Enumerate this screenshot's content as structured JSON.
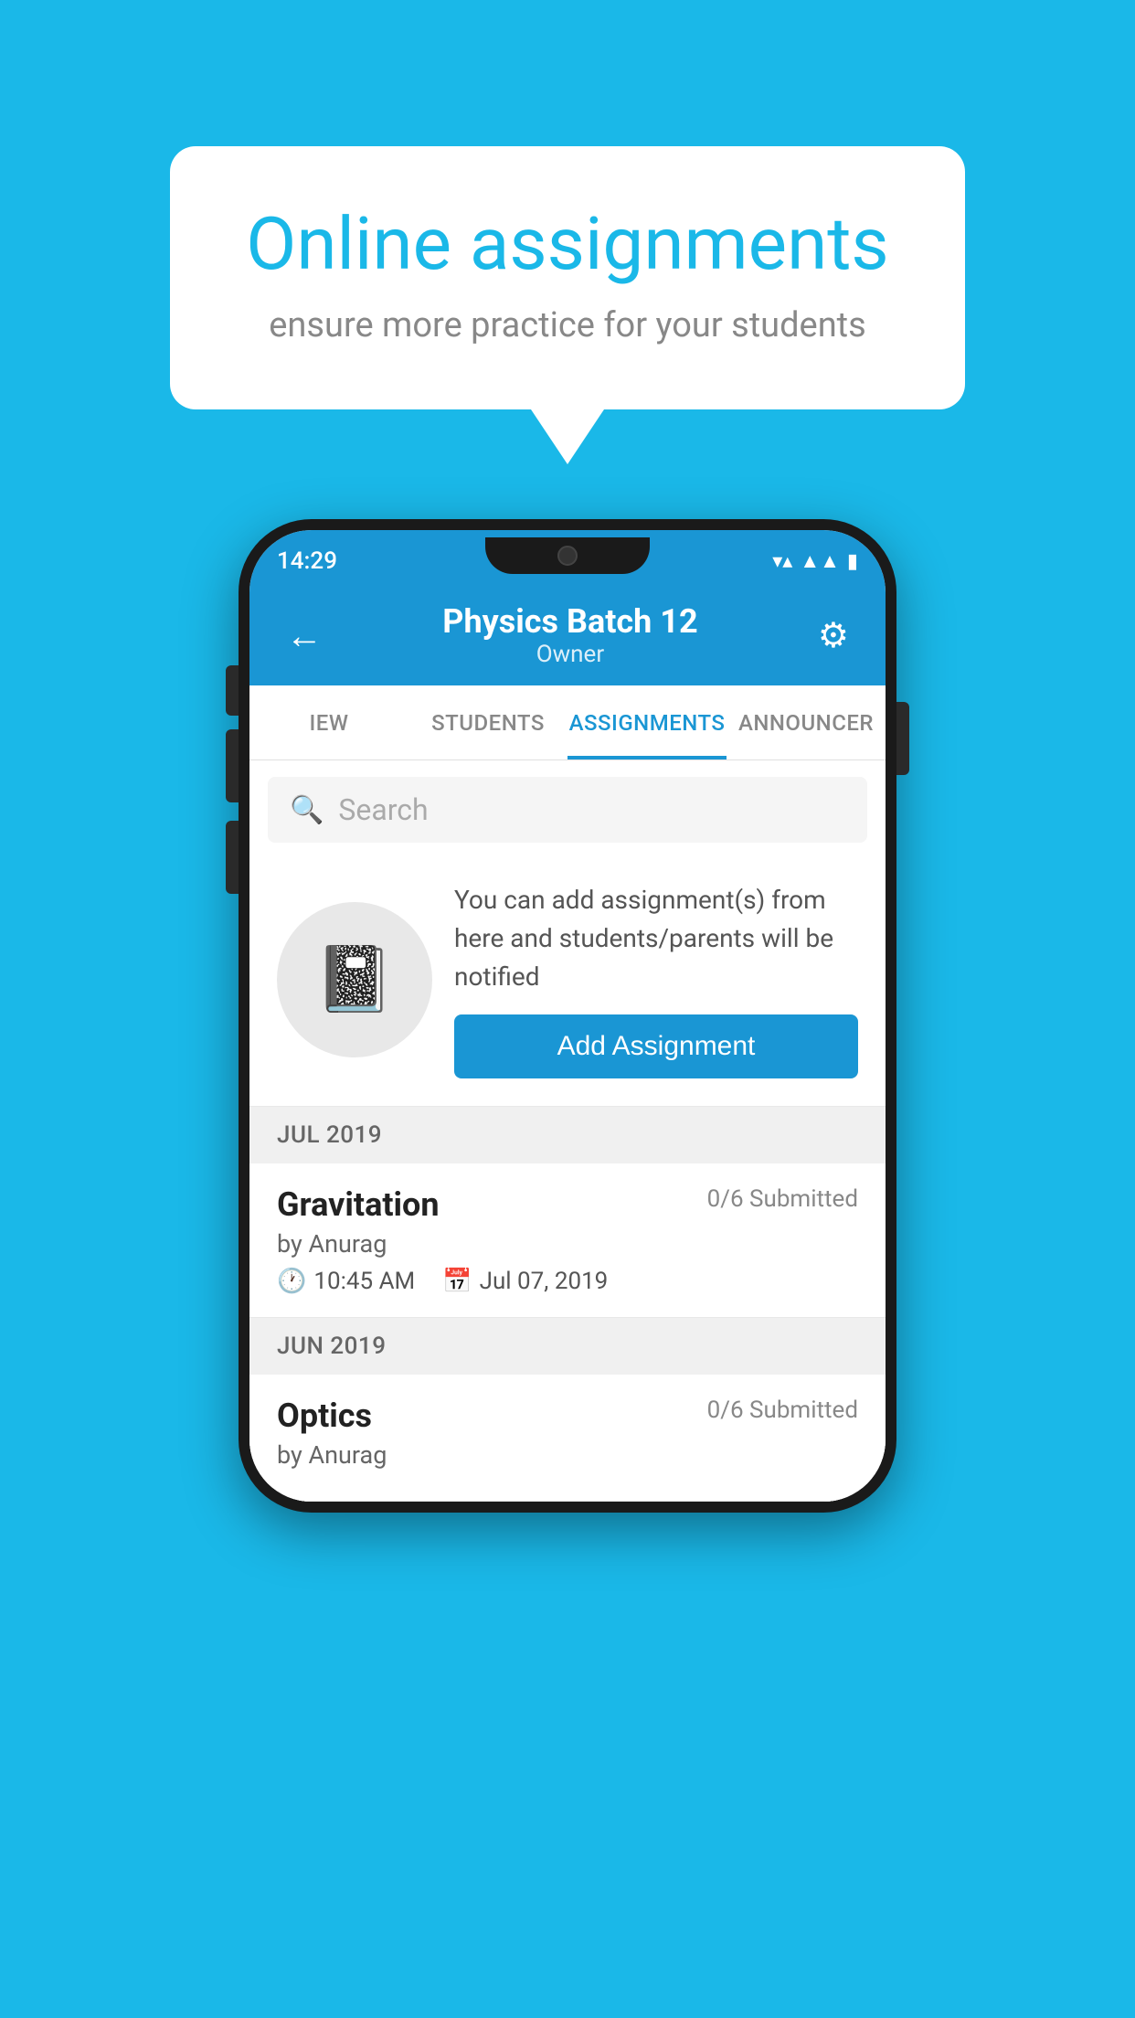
{
  "background": {
    "color": "#1ab8e8"
  },
  "speech_bubble": {
    "title": "Online assignments",
    "subtitle": "ensure more practice for your students"
  },
  "phone": {
    "status_bar": {
      "time": "14:29"
    },
    "app_bar": {
      "title": "Physics Batch 12",
      "subtitle": "Owner",
      "back_label": "←",
      "settings_label": "⚙"
    },
    "tabs": [
      {
        "label": "IEW",
        "active": false
      },
      {
        "label": "STUDENTS",
        "active": false
      },
      {
        "label": "ASSIGNMENTS",
        "active": true
      },
      {
        "label": "ANNOUNCER",
        "active": false
      }
    ],
    "search": {
      "placeholder": "Search"
    },
    "promo": {
      "text": "You can add assignment(s) from here and students/parents will be notified",
      "button_label": "Add Assignment"
    },
    "sections": [
      {
        "month": "JUL 2019",
        "assignments": [
          {
            "name": "Gravitation",
            "submitted": "0/6 Submitted",
            "by": "by Anurag",
            "time": "10:45 AM",
            "date": "Jul 07, 2019"
          }
        ]
      },
      {
        "month": "JUN 2019",
        "assignments": [
          {
            "name": "Optics",
            "submitted": "0/6 Submitted",
            "by": "by Anurag",
            "time": "",
            "date": ""
          }
        ]
      }
    ]
  }
}
